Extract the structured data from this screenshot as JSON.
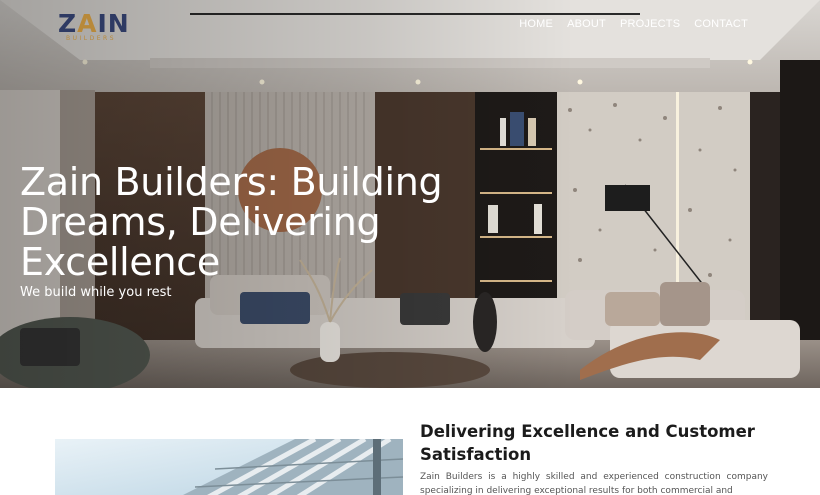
{
  "brand": {
    "logo_text_left": "Z",
    "logo_text_mark": "A",
    "logo_text_right": "IN",
    "logo_sub": "BUILDERS",
    "colors": {
      "navy": "#2e3a63",
      "gold": "#b8893a"
    }
  },
  "nav": {
    "items": [
      {
        "label": "HOME"
      },
      {
        "label": "ABOUT"
      },
      {
        "label": "PROJECTS"
      },
      {
        "label": "CONTACT"
      }
    ]
  },
  "hero": {
    "title": "Zain Builders: Building Dreams, Delivering Excellence",
    "subtitle": "We build while you rest"
  },
  "about": {
    "title": "Delivering Excellence and Customer Satisfaction",
    "text": "Zain Builders is a highly skilled and experienced construction company specializing in delivering exceptional results for both commercial and"
  }
}
